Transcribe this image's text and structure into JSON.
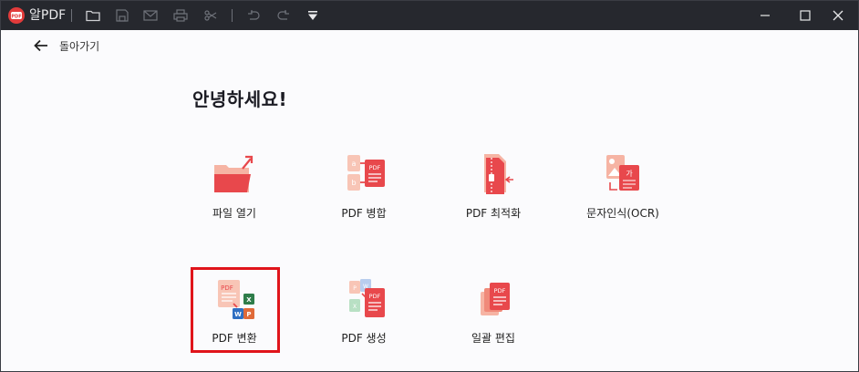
{
  "titlebar": {
    "app_name": "알PDF",
    "toolbar": [
      "folder-icon",
      "save-icon",
      "mail-icon",
      "print-icon",
      "scissors-icon",
      "undo-icon",
      "redo-icon",
      "dropdown-icon"
    ],
    "window_controls": [
      "minimize",
      "maximize",
      "close"
    ]
  },
  "nav": {
    "back_label": "돌아가기"
  },
  "main": {
    "greeting": "안녕하세요!",
    "tiles": [
      {
        "label": "파일 열기"
      },
      {
        "label": "PDF 병합"
      },
      {
        "label": "PDF 최적화"
      },
      {
        "label": "문자인식(OCR)"
      },
      {
        "label": "PDF 변환"
      },
      {
        "label": "PDF 생성"
      },
      {
        "label": "일괄 편집"
      }
    ],
    "highlighted_tile": "PDF 변환"
  },
  "colors": {
    "titlebar": "#26282e",
    "accent": "#e0464b",
    "accent_light": "#f7b3a6",
    "highlight": "#e0141b"
  }
}
